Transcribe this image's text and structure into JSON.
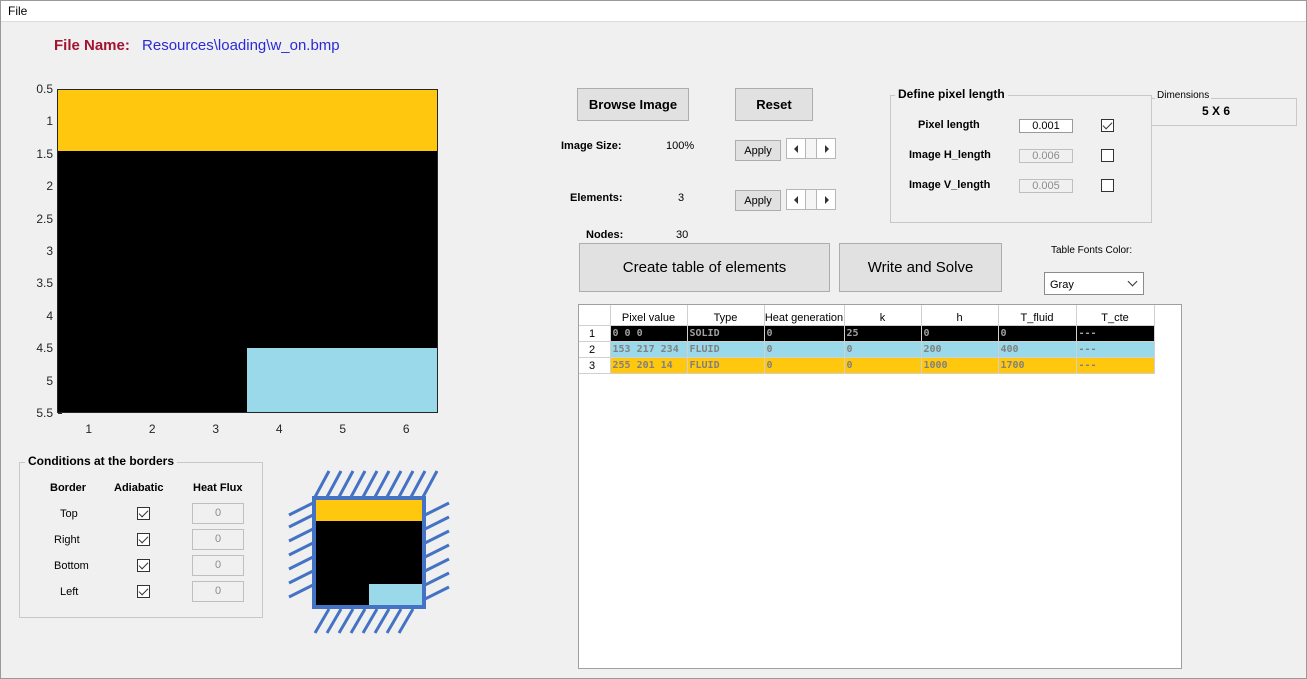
{
  "menu": {
    "file": "File"
  },
  "file_info": {
    "label": "File Name:",
    "path": "Resources\\loading\\w_on.bmp"
  },
  "plot": {
    "y_ticks": [
      "0.5",
      "1",
      "1.5",
      "2",
      "2.5",
      "3",
      "3.5",
      "4",
      "4.5",
      "5",
      "5.5"
    ],
    "x_ticks": [
      "1",
      "2",
      "3",
      "4",
      "5",
      "6"
    ],
    "colors": {
      "yellow": "#ffc80e",
      "black": "#000000",
      "light_blue": "#99d9ea"
    }
  },
  "buttons": {
    "browse": "Browse Image",
    "reset": "Reset",
    "apply_size": "Apply",
    "apply_elements": "Apply",
    "create_table": "Create table of elements",
    "write_solve": "Write and Solve"
  },
  "image_info": {
    "size_label": "Image Size:",
    "size_value": "100%",
    "elements_label": "Elements:",
    "elements_value": "3",
    "nodes_label": "Nodes:",
    "nodes_value": "30"
  },
  "pixel_length": {
    "title": "Define pixel length",
    "rows": [
      {
        "label": "Pixel length",
        "value": "0.001",
        "checked": true,
        "disabled": false
      },
      {
        "label": "Image H_length",
        "value": "0.006",
        "checked": false,
        "disabled": true
      },
      {
        "label": "Image V_length",
        "value": "0.005",
        "checked": false,
        "disabled": true
      }
    ]
  },
  "dimensions": {
    "title": "Dimensions",
    "value": "5 X 6"
  },
  "font_color": {
    "label": "Table Fonts Color:",
    "selected": "Gray"
  },
  "table": {
    "headers": [
      "Pixel value",
      "Type",
      "Heat generation",
      "k",
      "h",
      "T_fluid",
      "T_cte"
    ],
    "rows": [
      {
        "index": "1",
        "bg": "#000000",
        "fg": "#a0a0a0",
        "cells": [
          "0 0 0",
          "SOLID",
          "0",
          "25",
          "0",
          "0",
          "---"
        ]
      },
      {
        "index": "2",
        "bg": "#99d9ea",
        "fg": "#808080",
        "cells": [
          "153 217 234",
          "FLUID",
          "0",
          "0",
          "200",
          "400",
          "---"
        ]
      },
      {
        "index": "3",
        "bg": "#ffc80e",
        "fg": "#808080",
        "cells": [
          "255 201  14",
          "FLUID",
          "0",
          "0",
          "1000",
          "1700",
          "---"
        ]
      }
    ]
  },
  "borders": {
    "title": "Conditions at the borders",
    "headers": [
      "Border",
      "Adiabatic",
      "Heat Flux"
    ],
    "rows": [
      {
        "name": "Top",
        "adiabatic": true,
        "flux": "0"
      },
      {
        "name": "Right",
        "adiabatic": true,
        "flux": "0"
      },
      {
        "name": "Bottom",
        "adiabatic": true,
        "flux": "0"
      },
      {
        "name": "Left",
        "adiabatic": true,
        "flux": "0"
      }
    ]
  },
  "preview_colors": {
    "frame": "#4472c4",
    "hatch": "#4472c4"
  }
}
